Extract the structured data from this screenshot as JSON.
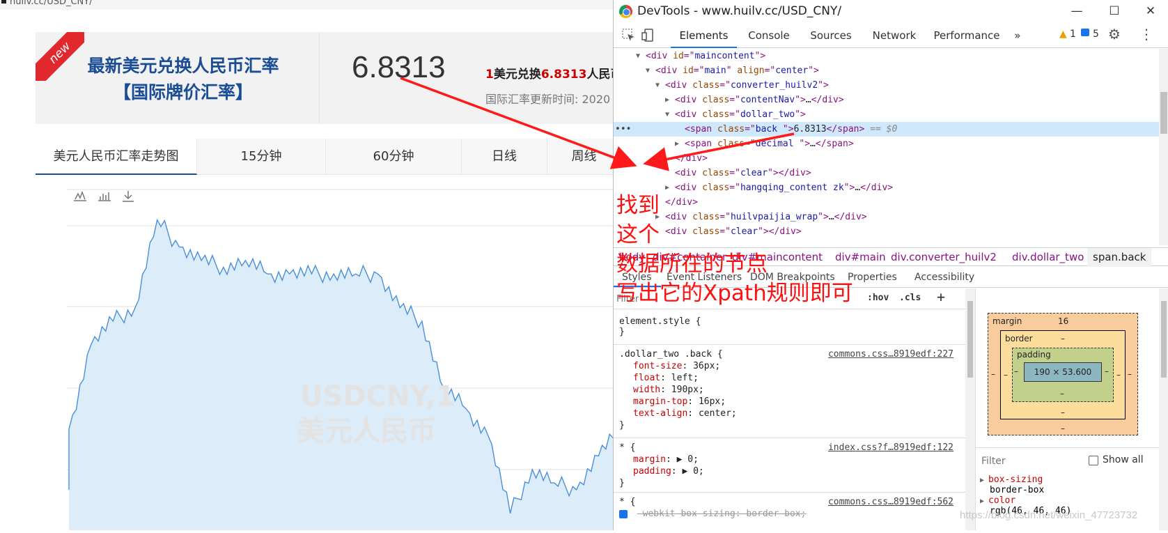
{
  "browser": {
    "url_fragment": "huilv.cc/USD_CNY/"
  },
  "site": {
    "badge": "new",
    "title_line1": "最新美元兑换人民币汇率",
    "title_line2": "【国际牌价汇率】",
    "rate": "6.8313",
    "desc_one": "1",
    "desc_mid": "美元兑换",
    "desc_rate": "6.8313",
    "desc_tail": "人民币",
    "update_time": "国际汇率更新时间: 2020",
    "tabs": [
      "美元人民币汇率走势图",
      "15分钟",
      "60分钟",
      "日线",
      "周线"
    ],
    "chart_watermark_1": "USDCNY,1",
    "chart_watermark_2": "美元人民币"
  },
  "chart_data": {
    "type": "area",
    "title": "",
    "xlabel": "",
    "ylabel": "",
    "x": [
      0,
      4,
      8,
      12,
      16,
      20,
      24,
      28,
      32,
      36,
      40,
      44,
      48,
      52,
      56,
      60,
      64,
      68,
      72,
      76,
      80,
      84,
      88,
      92,
      96,
      100
    ],
    "values": [
      0.3,
      0.55,
      0.62,
      0.66,
      0.92,
      0.84,
      0.8,
      0.78,
      0.8,
      0.76,
      0.76,
      0.76,
      0.76,
      0.76,
      0.76,
      0.66,
      0.62,
      0.42,
      0.36,
      0.28,
      0.05,
      0.18,
      0.14,
      0.12,
      0.22,
      0.3
    ],
    "color": "#4a90d9"
  },
  "devtools": {
    "title": "DevTools - www.huilv.cc/USD_CNY/",
    "tabs": [
      "Elements",
      "Console",
      "Sources",
      "Network",
      "Performance",
      "»"
    ],
    "warn_count": "1",
    "msg_count": "5",
    "dom_lines": [
      {
        "indent": 0,
        "arrow": "▼",
        "tag": "div",
        "attr": "id",
        "val": "maincontent",
        "rest": ""
      },
      {
        "indent": 1,
        "arrow": "▼",
        "tag": "div",
        "attr": "id",
        "val": "main",
        "extra_attr": "align",
        "extra_val": "center",
        "rest": ""
      },
      {
        "indent": 2,
        "arrow": "▼",
        "tag": "div",
        "attr": "class",
        "val": "converter_huilv2",
        "rest": ""
      },
      {
        "indent": 3,
        "arrow": "▶",
        "tag": "div",
        "attr": "class",
        "val": "contentNav",
        "rest": "…</div>"
      },
      {
        "indent": 3,
        "arrow": "▼",
        "tag": "div",
        "attr": "class",
        "val": "dollar_two",
        "rest": ""
      },
      {
        "indent": 4,
        "arrow": "",
        "tag": "span",
        "attr": "class",
        "val": "back ",
        "rest": "6.8313</span>",
        "selected": true,
        "eq": "== $0"
      },
      {
        "indent": 4,
        "arrow": "▶",
        "tag": "span",
        "attr": "class",
        "val": "decimal ",
        "rest": "…</span>"
      },
      {
        "indent": 3,
        "arrow": "",
        "tag": "/div",
        "attr": "",
        "val": "",
        "rest": ""
      },
      {
        "indent": 3,
        "arrow": "",
        "tag": "div",
        "attr": "class",
        "val": "clear",
        "rest": "</div>"
      },
      {
        "indent": 3,
        "arrow": "▶",
        "tag": "div",
        "attr": "class",
        "val": "hangqing_content zk",
        "rest": "…</div>"
      },
      {
        "indent": 2,
        "arrow": "",
        "tag": "/div",
        "attr": "",
        "val": "",
        "rest": ""
      },
      {
        "indent": 2,
        "arrow": "▶",
        "tag": "div",
        "attr": "class",
        "val": "huilvpaijia_wrap",
        "rest": "…</div>"
      },
      {
        "indent": 2,
        "arrow": "",
        "tag": "div",
        "attr": "class",
        "val": "clear",
        "rest": "</div>"
      }
    ],
    "breadcrumbs": [
      "body",
      "div#container",
      "div#maincontent",
      "div#main",
      "div.converter_huilv2",
      "div.dollar_two",
      "span.back"
    ],
    "subtabs": [
      "Styles",
      "Event Listeners",
      "DOM Breakpoints",
      "Properties",
      "Accessibility"
    ],
    "filter_placeholder": "Filter",
    "hov": ":hov",
    "cls": ".cls",
    "plus": "+",
    "element_style": "element.style {",
    "close_brace": "}",
    "rule1_selector": ".dollar_two .back {",
    "rule1_src": "commons.css…8919edf:227",
    "rule1_props": [
      {
        "name": "font-size",
        "value": "36px;"
      },
      {
        "name": "float",
        "value": "left;"
      },
      {
        "name": "width",
        "value": "190px;"
      },
      {
        "name": "margin-top",
        "value": "16px;"
      },
      {
        "name": "text-align",
        "value": "center;"
      }
    ],
    "rule2_selector": "* {",
    "rule2_src": "index.css?f…8919edf:122",
    "rule2_props": [
      {
        "name": "margin",
        "value": "▶ 0;"
      },
      {
        "name": "padding",
        "value": "▶ 0;"
      }
    ],
    "rule3_selector": "* {",
    "rule3_src": "commons.css…8919edf:562",
    "rule3_prop": "-webkit-box-sizing: border-box;",
    "box": {
      "margin_label": "margin",
      "margin_top": "16",
      "border_label": "border",
      "padding_label": "padding",
      "dash": "–",
      "content": "190 × 53.600"
    },
    "computed_filter": "Filter",
    "show_all": "Show all",
    "computed": [
      {
        "name": "box-sizing",
        "value": "border-box"
      },
      {
        "name": "color",
        "value": "rgb(46, 46, 46)"
      }
    ]
  },
  "annotation": {
    "line1": "找到",
    "line2": "这个",
    "line3": "数据所在的节点",
    "line4": "写出它的Xpath规则即可"
  },
  "watermark": "https://blog.csdn.net/weixin_47723732"
}
